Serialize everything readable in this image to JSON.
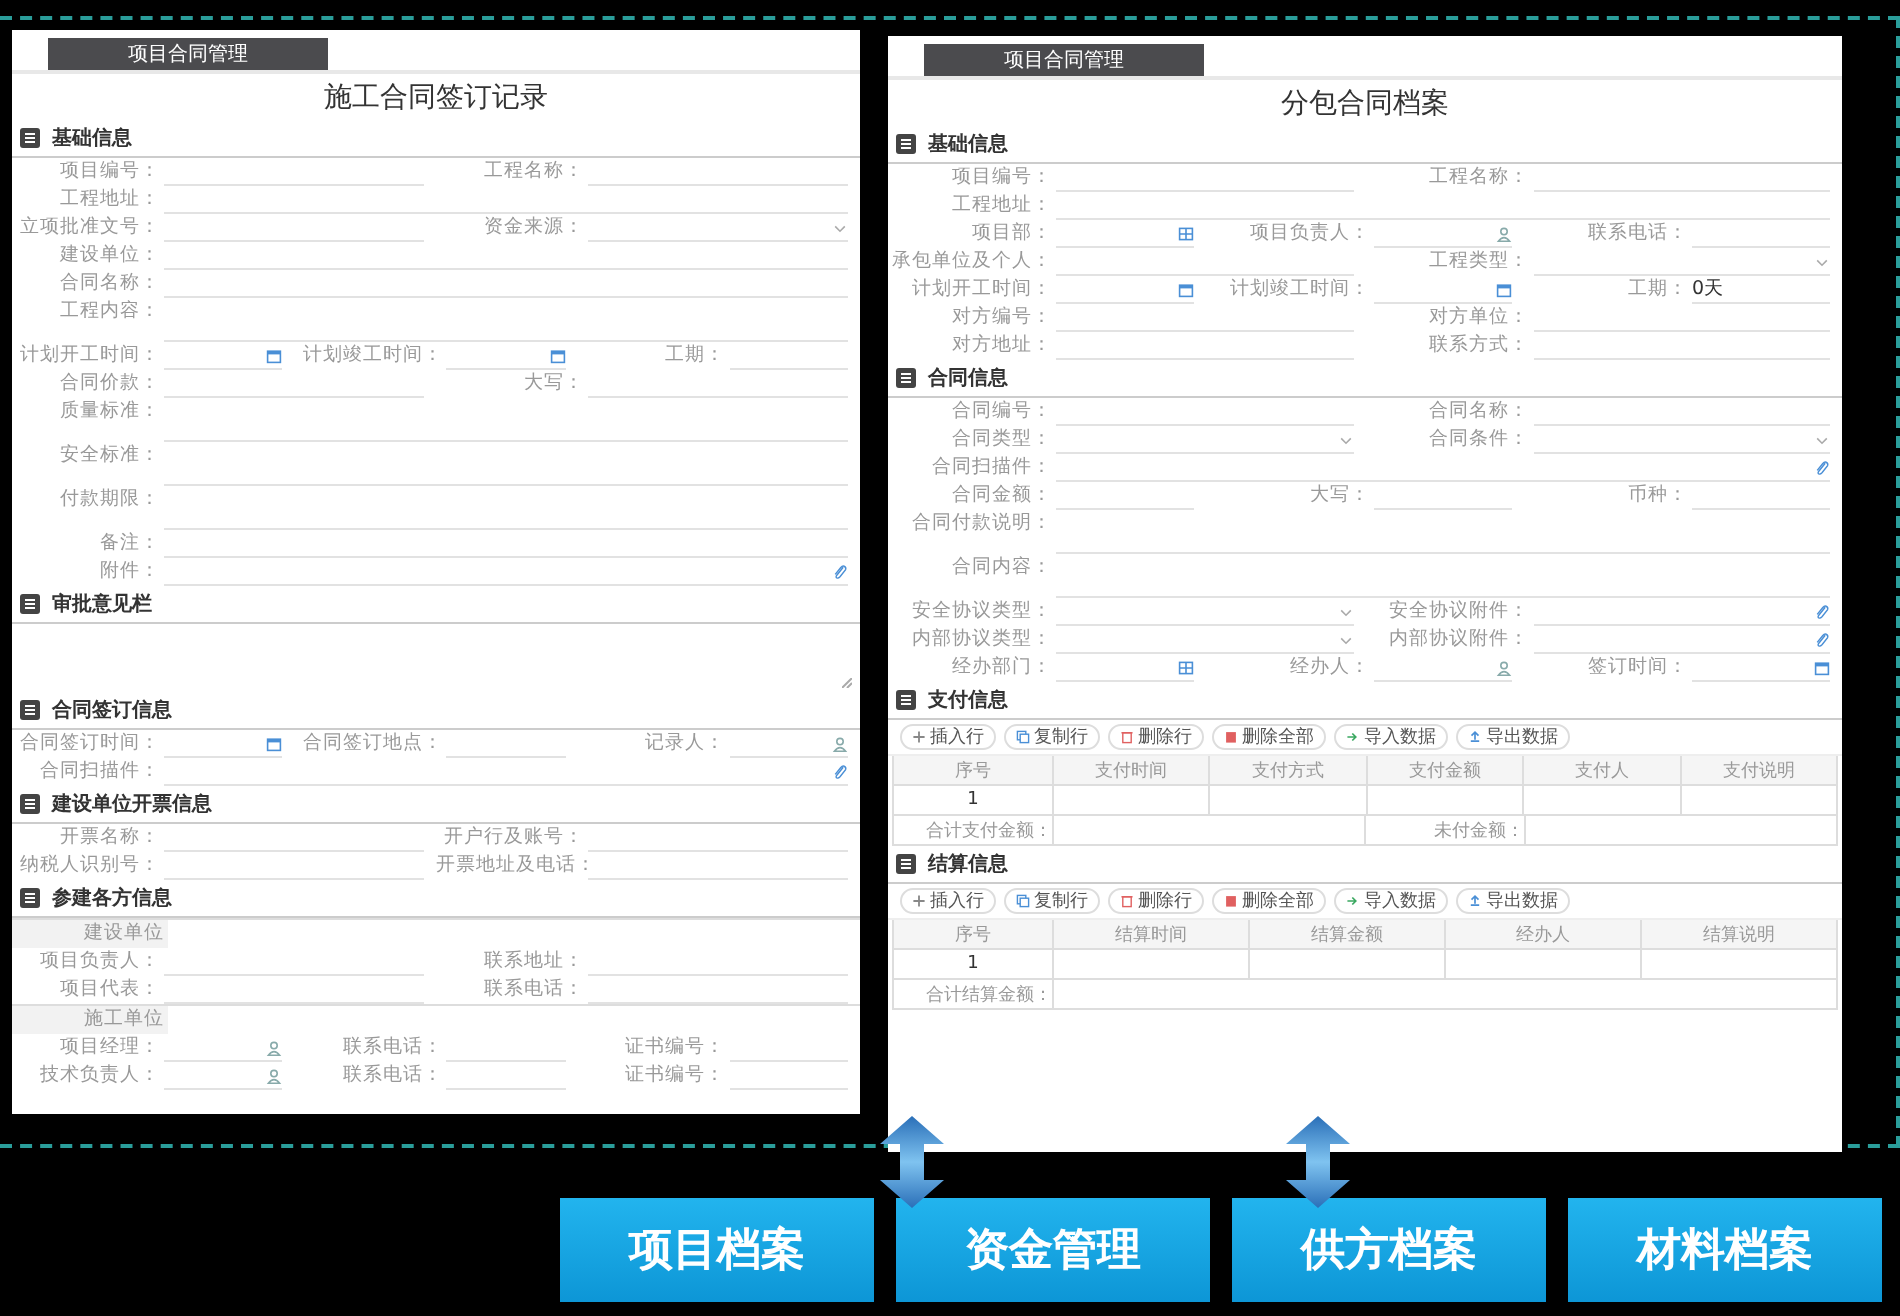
{
  "panels": [
    {
      "tab": "项目合同管理",
      "title": "施工合同签订记录",
      "sections": [
        {
          "title": "基础信息",
          "kind": "form",
          "rows": [
            {
              "kind": "fields",
              "fields": [
                {
                  "label": "项目编号：",
                  "kind": "text"
                },
                {
                  "label": "工程名称：",
                  "kind": "text"
                }
              ]
            },
            {
              "kind": "fields",
              "fields": [
                {
                  "label": "工程地址：",
                  "kind": "text"
                }
              ]
            },
            {
              "kind": "fields",
              "fields": [
                {
                  "label": "立项批准文号：",
                  "kind": "text"
                },
                {
                  "label": "资金来源：",
                  "kind": "select"
                }
              ]
            },
            {
              "kind": "fields",
              "fields": [
                {
                  "label": "建设单位：",
                  "kind": "text"
                }
              ]
            },
            {
              "kind": "fields",
              "fields": [
                {
                  "label": "合同名称：",
                  "kind": "text"
                }
              ]
            },
            {
              "kind": "fields",
              "fields": [
                {
                  "label": "工程内容：",
                  "kind": "tall"
                }
              ]
            },
            {
              "kind": "fields",
              "fields": [
                {
                  "label": "计划开工时间：",
                  "kind": "date"
                },
                {
                  "label": "计划竣工时间：",
                  "kind": "date"
                },
                {
                  "label": "工期：",
                  "kind": "text"
                }
              ]
            },
            {
              "kind": "fields",
              "fields": [
                {
                  "label": "合同价款：",
                  "kind": "text"
                },
                {
                  "label": "大写：",
                  "kind": "text"
                }
              ]
            },
            {
              "kind": "fields",
              "fields": [
                {
                  "label": "质量标准：",
                  "kind": "tall"
                }
              ]
            },
            {
              "kind": "fields",
              "fields": [
                {
                  "label": "安全标准：",
                  "kind": "tall"
                }
              ]
            },
            {
              "kind": "fields",
              "fields": [
                {
                  "label": "付款期限：",
                  "kind": "tall"
                }
              ]
            },
            {
              "kind": "fields",
              "fields": [
                {
                  "label": "备注：",
                  "kind": "text"
                }
              ]
            },
            {
              "kind": "fields",
              "fields": [
                {
                  "label": "附件：",
                  "kind": "attach"
                }
              ]
            }
          ]
        },
        {
          "title": "审批意见栏",
          "kind": "textarea"
        },
        {
          "title": "合同签订信息",
          "kind": "form",
          "rows": [
            {
              "kind": "fields",
              "fields": [
                {
                  "label": "合同签订时间：",
                  "kind": "date"
                },
                {
                  "label": "合同签订地点：",
                  "kind": "text"
                },
                {
                  "label": "记录人：",
                  "kind": "person"
                }
              ]
            },
            {
              "kind": "fields",
              "fields": [
                {
                  "label": "合同扫描件：",
                  "kind": "attach"
                }
              ]
            }
          ]
        },
        {
          "title": "建设单位开票信息",
          "kind": "form",
          "rows": [
            {
              "kind": "fields",
              "fields": [
                {
                  "label": "开票名称：",
                  "kind": "text"
                },
                {
                  "label": "开户行及账号：",
                  "kind": "text"
                }
              ]
            },
            {
              "kind": "fields",
              "fields": [
                {
                  "label": "纳税人识别号：",
                  "kind": "text"
                },
                {
                  "label": "开票地址及电话：",
                  "kind": "text"
                }
              ]
            }
          ]
        },
        {
          "title": "参建各方信息",
          "kind": "form",
          "rows": [
            {
              "kind": "subheader",
              "label": "建设单位"
            },
            {
              "kind": "fields",
              "fields": [
                {
                  "label": "项目负责人：",
                  "kind": "text"
                },
                {
                  "label": "联系地址：",
                  "kind": "text"
                }
              ]
            },
            {
              "kind": "fields",
              "fields": [
                {
                  "label": "项目代表：",
                  "kind": "text"
                },
                {
                  "label": "联系电话：",
                  "kind": "text"
                }
              ]
            },
            {
              "kind": "subheader",
              "label": "施工单位"
            },
            {
              "kind": "fields",
              "fields": [
                {
                  "label": "项目经理：",
                  "kind": "person"
                },
                {
                  "label": "联系电话：",
                  "kind": "text"
                },
                {
                  "label": "证书编号：",
                  "kind": "text"
                }
              ]
            },
            {
              "kind": "fields",
              "fields": [
                {
                  "label": "技术负责人：",
                  "kind": "person"
                },
                {
                  "label": "联系电话：",
                  "kind": "text"
                },
                {
                  "label": "证书编号：",
                  "kind": "text"
                }
              ]
            }
          ]
        }
      ]
    },
    {
      "tab": "项目合同管理",
      "title": "分包合同档案",
      "sections": [
        {
          "title": "基础信息",
          "kind": "form",
          "rows": [
            {
              "kind": "fields",
              "fields": [
                {
                  "label": "项目编号：",
                  "kind": "text"
                },
                {
                  "label": "工程名称：",
                  "kind": "text"
                }
              ]
            },
            {
              "kind": "fields",
              "fields": [
                {
                  "label": "工程地址：",
                  "kind": "text"
                }
              ]
            },
            {
              "kind": "fields",
              "fields": [
                {
                  "label": "项目部：",
                  "kind": "org"
                },
                {
                  "label": "项目负责人：",
                  "kind": "person"
                },
                {
                  "label": "联系电话：",
                  "kind": "text"
                }
              ]
            },
            {
              "kind": "fields",
              "fields": [
                {
                  "label": "承包单位及个人：",
                  "kind": "text"
                },
                {
                  "label": "工程类型：",
                  "kind": "select"
                }
              ]
            },
            {
              "kind": "fields",
              "fields": [
                {
                  "label": "计划开工时间：",
                  "kind": "date"
                },
                {
                  "label": "计划竣工时间：",
                  "kind": "date"
                },
                {
                  "label": "工期：",
                  "kind": "text",
                  "value": "0天"
                }
              ]
            },
            {
              "kind": "fields",
              "fields": [
                {
                  "label": "对方编号：",
                  "kind": "text"
                },
                {
                  "label": "对方单位：",
                  "kind": "text"
                }
              ]
            },
            {
              "kind": "fields",
              "fields": [
                {
                  "label": "对方地址：",
                  "kind": "text"
                },
                {
                  "label": "联系方式：",
                  "kind": "text"
                }
              ]
            }
          ]
        },
        {
          "title": "合同信息",
          "kind": "form",
          "rows": [
            {
              "kind": "fields",
              "fields": [
                {
                  "label": "合同编号：",
                  "kind": "text"
                },
                {
                  "label": "合同名称：",
                  "kind": "text"
                }
              ]
            },
            {
              "kind": "fields",
              "fields": [
                {
                  "label": "合同类型：",
                  "kind": "select"
                },
                {
                  "label": "合同条件：",
                  "kind": "select"
                }
              ]
            },
            {
              "kind": "fields",
              "fields": [
                {
                  "label": "合同扫描件：",
                  "kind": "attach"
                }
              ]
            },
            {
              "kind": "fields",
              "fields": [
                {
                  "label": "合同金额：",
                  "kind": "text"
                },
                {
                  "label": "大写：",
                  "kind": "text"
                },
                {
                  "label": "币种：",
                  "kind": "text"
                }
              ]
            },
            {
              "kind": "fields",
              "fields": [
                {
                  "label": "合同付款说明：",
                  "kind": "tall"
                }
              ]
            },
            {
              "kind": "fields",
              "fields": [
                {
                  "label": "合同内容：",
                  "kind": "tall"
                }
              ]
            },
            {
              "kind": "fields",
              "fields": [
                {
                  "label": "安全协议类型：",
                  "kind": "select"
                },
                {
                  "label": "安全协议附件：",
                  "kind": "attach"
                }
              ]
            },
            {
              "kind": "fields",
              "fields": [
                {
                  "label": "内部协议类型：",
                  "kind": "select"
                },
                {
                  "label": "内部协议附件：",
                  "kind": "attach"
                }
              ]
            },
            {
              "kind": "fields",
              "fields": [
                {
                  "label": "经办部门：",
                  "kind": "org"
                },
                {
                  "label": "经办人：",
                  "kind": "person"
                },
                {
                  "label": "签订时间：",
                  "kind": "date"
                }
              ]
            }
          ]
        },
        {
          "title": "支付信息",
          "kind": "table",
          "toolbar": [
            {
              "label": "插入行",
              "kind": "plus"
            },
            {
              "label": "复制行",
              "kind": "copy"
            },
            {
              "label": "删除行",
              "kind": "delete"
            },
            {
              "label": "删除全部",
              "kind": "delete-all"
            },
            {
              "label": "导入数据",
              "kind": "import"
            },
            {
              "label": "导出数据",
              "kind": "export"
            }
          ],
          "columns": [
            {
              "label": "序号",
              "kind": "index"
            },
            {
              "label": "支付时间",
              "kind": "date"
            },
            {
              "label": "支付方式",
              "kind": "select"
            },
            {
              "label": "支付金额",
              "kind": "text"
            },
            {
              "label": "支付人",
              "kind": "person"
            },
            {
              "label": "支付说明",
              "kind": "text"
            }
          ],
          "rows": [
            {
              "index": "1"
            }
          ],
          "footer": [
            {
              "label": "合计支付金额："
            },
            {
              "label": "未付金额："
            }
          ]
        },
        {
          "title": "结算信息",
          "kind": "table",
          "toolbar": [
            {
              "label": "插入行",
              "kind": "plus"
            },
            {
              "label": "复制行",
              "kind": "copy"
            },
            {
              "label": "删除行",
              "kind": "delete"
            },
            {
              "label": "删除全部",
              "kind": "delete-all"
            },
            {
              "label": "导入数据",
              "kind": "import"
            },
            {
              "label": "导出数据",
              "kind": "export"
            }
          ],
          "columns": [
            {
              "label": "序号",
              "kind": "index"
            },
            {
              "label": "结算时间",
              "kind": "date"
            },
            {
              "label": "结算金额",
              "kind": "text"
            },
            {
              "label": "经办人",
              "kind": "person"
            },
            {
              "label": "结算说明",
              "kind": "text"
            }
          ],
          "rows": [
            {
              "index": "1"
            }
          ],
          "footer": [
            {
              "label": "合计结算金额："
            }
          ]
        }
      ]
    }
  ],
  "nav_buttons": [
    "项目档案",
    "资金管理",
    "供方档案",
    "材料档案"
  ]
}
